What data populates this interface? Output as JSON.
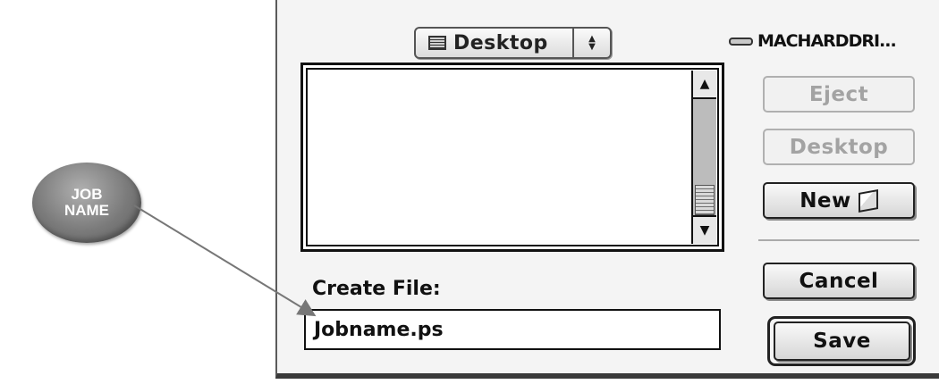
{
  "dialog": {
    "location_popup": {
      "label": "Desktop",
      "folder_icon": "folder-icon",
      "arrows_icon": "popup-arrows-icon"
    },
    "volume": {
      "name": "MACHARDDRI...",
      "icon": "hard-drive-icon"
    },
    "file_list": {
      "items": [],
      "scrollbar": {
        "up_icon": "scroll-up-icon",
        "down_icon": "scroll-down-icon"
      }
    },
    "buttons": {
      "eject": "Eject",
      "desktop": "Desktop",
      "new": "New",
      "new_icon": "new-folder-icon",
      "cancel": "Cancel",
      "save": "Save"
    },
    "create_file_label": "Create File:",
    "filename_value": "Jobname.ps"
  },
  "annotation": {
    "callout_text": "JOB NAME"
  },
  "colors": {
    "dialog_bg": "#f4f4f4",
    "callout": "#7a7a7a",
    "disabled_text": "#a3a3a3"
  }
}
